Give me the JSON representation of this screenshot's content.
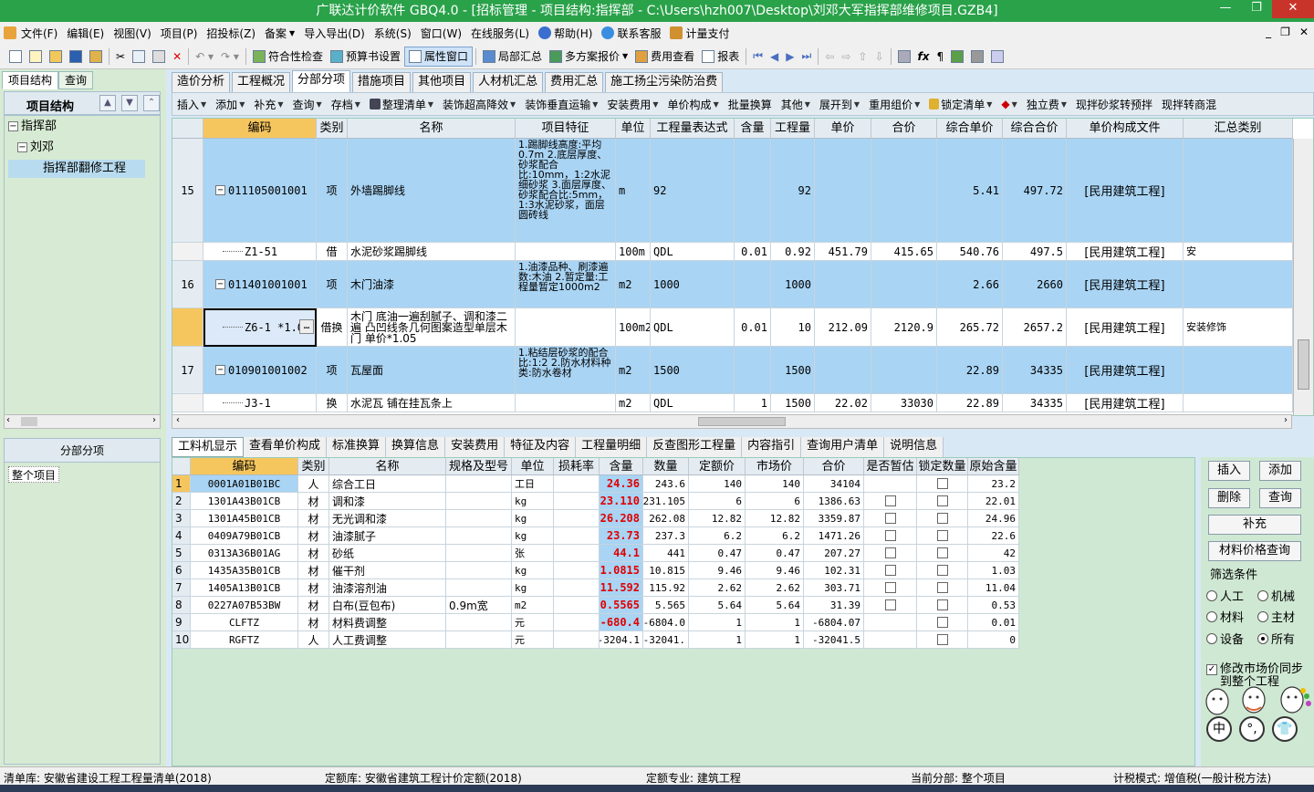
{
  "window": {
    "title": "广联达计价软件 GBQ4.0 - [招标管理 - 项目结构:指挥部 - C:\\Users\\hzh007\\Desktop\\刘邓大军指挥部维修项目.GZB4]"
  },
  "menu": {
    "items": [
      "文件(F)",
      "编辑(E)",
      "视图(V)",
      "项目(P)",
      "招投标(Z)",
      "备案",
      "导入导出(D)",
      "系统(S)",
      "窗口(W)",
      "在线服务(L)",
      "帮助(H)",
      "联系客服",
      "计量支付"
    ]
  },
  "toolbar": {
    "check": "符合性检查",
    "budget": "预算书设置",
    "attr_window": "属性窗口",
    "local_sum": "局部汇总",
    "multi_report": "多方案报价",
    "fee_view": "费用查看",
    "report": "报表"
  },
  "left": {
    "tab_structure": "项目结构",
    "tab_query": "查询",
    "header": "项目结构",
    "tree": [
      "指挥部",
      "刘邓",
      "指挥部翻修工程"
    ],
    "section_header": "分部分项",
    "section_item": "整个项目"
  },
  "tabs": [
    "造价分析",
    "工程概况",
    "分部分项",
    "措施项目",
    "其他项目",
    "人材机汇总",
    "费用汇总",
    "施工扬尘污染防治费"
  ],
  "subtoolbar": [
    "插入",
    "添加",
    "补充",
    "查询",
    "存档",
    "整理清单",
    "装饰超高降效",
    "装饰垂直运输",
    "安装费用",
    "单价构成",
    "批量换算",
    "其他",
    "展开到",
    "重用组价",
    "锁定清单",
    "独立费",
    "现拌砂浆转预拌",
    "现拌转商混"
  ],
  "grid": {
    "headers": [
      "",
      "编码",
      "类别",
      "名称",
      "项目特征",
      "单位",
      "工程量表达式",
      "含量",
      "工程量",
      "单价",
      "合价",
      "综合单价",
      "综合合价",
      "单价构成文件",
      "汇总类别"
    ],
    "rows": [
      {
        "no": "15",
        "code": "011105001001",
        "type": "项",
        "name": "外墙踢脚线",
        "feature": "1.踢脚线高度:平均0.7m 2.底层厚度、砂浆配合比:10mm，1:2水泥细砂浆 3.面层厚度、砂浆配合比:5mm，1:3水泥砂浆，面层圆砖线",
        "unit": "m",
        "expr": "92",
        "content": "",
        "qty": "92",
        "price": "",
        "total": "",
        "uprice": "5.41",
        "utotal": "497.72",
        "file": "[民用建筑工程]",
        "cat": ""
      },
      {
        "no": "",
        "code": "Z1-51",
        "type": "借",
        "name": "水泥砂浆踢脚线",
        "feature": "",
        "unit": "100m",
        "expr": "QDL",
        "content": "0.01",
        "qty": "0.92",
        "price": "451.79",
        "total": "415.65",
        "uprice": "540.76",
        "utotal": "497.5",
        "file": "[民用建筑工程]",
        "cat": "安"
      },
      {
        "no": "16",
        "code": "011401001001",
        "type": "项",
        "name": "木门油漆",
        "feature": "1.油漆品种、刷漆遍数:木油 2.暂定量:工程量暂定1000m2",
        "unit": "m2",
        "expr": "1000",
        "content": "",
        "qty": "1000",
        "price": "",
        "total": "",
        "uprice": "2.66",
        "utotal": "2660",
        "file": "[民用建筑工程]",
        "cat": ""
      },
      {
        "no": "",
        "code": "Z6-1 *1.05",
        "type": "借换",
        "name": "木门 底油一遍刮腻子、调和漆二遍 凸凹线条几何图案造型单层木门 单价*1.05",
        "feature": "",
        "unit": "100m2",
        "expr": "QDL",
        "content": "0.01",
        "qty": "10",
        "price": "212.09",
        "total": "2120.9",
        "uprice": "265.72",
        "utotal": "2657.2",
        "file": "[民用建筑工程]",
        "cat": "安装修饰"
      },
      {
        "no": "17",
        "code": "010901001002",
        "type": "项",
        "name": "瓦屋面",
        "feature": "1.粘结层砂浆的配合比:1:2 2.防水材料种类:防水卷材",
        "unit": "m2",
        "expr": "1500",
        "content": "",
        "qty": "1500",
        "price": "",
        "total": "",
        "uprice": "22.89",
        "utotal": "34335",
        "file": "[民用建筑工程]",
        "cat": ""
      },
      {
        "no": "",
        "code": "J3-1",
        "type": "换",
        "name": "水泥瓦 铺在挂瓦条上",
        "feature": "",
        "unit": "m2",
        "expr": "QDL",
        "content": "1",
        "qty": "1500",
        "price": "22.02",
        "total": "33030",
        "uprice": "22.89",
        "utotal": "34335",
        "file": "[民用建筑工程]",
        "cat": ""
      }
    ]
  },
  "bottom_tabs": [
    "工料机显示",
    "查看单价构成",
    "标准换算",
    "换算信息",
    "安装费用",
    "特征及内容",
    "工程量明细",
    "反查图形工程量",
    "内容指引",
    "查询用户清单",
    "说明信息"
  ],
  "materials": {
    "headers": [
      "",
      "编码",
      "类别",
      "名称",
      "规格及型号",
      "单位",
      "损耗率",
      "含量",
      "数量",
      "定额价",
      "市场价",
      "合价",
      "是否暂估",
      "锁定数量",
      "原始含量"
    ],
    "rows": [
      {
        "no": "1",
        "code": "0001A01B01BC",
        "type": "人",
        "name": "综合工日",
        "spec": "",
        "unit": "工日",
        "loss": "",
        "content": "24.36",
        "qty": "243.6",
        "dprice": "140",
        "mprice": "140",
        "total": "34104",
        "est": false,
        "lock": true,
        "orig": "23.2"
      },
      {
        "no": "2",
        "code": "1301A43B01CB",
        "type": "材",
        "name": "调和漆",
        "spec": "",
        "unit": "kg",
        "loss": "",
        "content": "23.110",
        "qty": "231.105",
        "dprice": "6",
        "mprice": "6",
        "total": "1386.63",
        "est": true,
        "lock": true,
        "orig": "22.01"
      },
      {
        "no": "3",
        "code": "1301A45B01CB",
        "type": "材",
        "name": "无光调和漆",
        "spec": "",
        "unit": "kg",
        "loss": "",
        "content": "26.208",
        "qty": "262.08",
        "dprice": "12.82",
        "mprice": "12.82",
        "total": "3359.87",
        "est": true,
        "lock": true,
        "orig": "24.96"
      },
      {
        "no": "4",
        "code": "0409A79B01CB",
        "type": "材",
        "name": "油漆腻子",
        "spec": "",
        "unit": "kg",
        "loss": "",
        "content": "23.73",
        "qty": "237.3",
        "dprice": "6.2",
        "mprice": "6.2",
        "total": "1471.26",
        "est": true,
        "lock": true,
        "orig": "22.6"
      },
      {
        "no": "5",
        "code": "0313A36B01AG",
        "type": "材",
        "name": "砂纸",
        "spec": "",
        "unit": "张",
        "loss": "",
        "content": "44.1",
        "qty": "441",
        "dprice": "0.47",
        "mprice": "0.47",
        "total": "207.27",
        "est": true,
        "lock": true,
        "orig": "42"
      },
      {
        "no": "6",
        "code": "1435A35B01CB",
        "type": "材",
        "name": "催干剂",
        "spec": "",
        "unit": "kg",
        "loss": "",
        "content": "1.0815",
        "qty": "10.815",
        "dprice": "9.46",
        "mprice": "9.46",
        "total": "102.31",
        "est": true,
        "lock": true,
        "orig": "1.03"
      },
      {
        "no": "7",
        "code": "1405A13B01CB",
        "type": "材",
        "name": "油漆溶剂油",
        "spec": "",
        "unit": "kg",
        "loss": "",
        "content": "11.592",
        "qty": "115.92",
        "dprice": "2.62",
        "mprice": "2.62",
        "total": "303.71",
        "est": true,
        "lock": true,
        "orig": "11.04"
      },
      {
        "no": "8",
        "code": "0227A07B53BW",
        "type": "材",
        "name": "白布(豆包布)",
        "spec": "0.9m宽",
        "unit": "m2",
        "loss": "",
        "content": "0.5565",
        "qty": "5.565",
        "dprice": "5.64",
        "mprice": "5.64",
        "total": "31.39",
        "est": true,
        "lock": true,
        "orig": "0.53"
      },
      {
        "no": "9",
        "code": "CLFTZ",
        "type": "材",
        "name": "材料费调整",
        "spec": "",
        "unit": "元",
        "loss": "",
        "content": "-680.4",
        "qty": "-6804.0",
        "dprice": "1",
        "mprice": "1",
        "total": "-6804.07",
        "est": false,
        "lock": true,
        "orig": "0.01"
      },
      {
        "no": "10",
        "code": "RGFTZ",
        "type": "人",
        "name": "人工费调整",
        "spec": "",
        "unit": "元",
        "loss": "",
        "content": "-3204.1",
        "qty": "-32041.",
        "dprice": "1",
        "mprice": "1",
        "total": "-32041.5",
        "est": false,
        "lock": true,
        "orig": "0"
      }
    ]
  },
  "right_panel": {
    "insert": "插入",
    "add": "添加",
    "delete": "删除",
    "query": "查询",
    "supplement": "补充",
    "price_query": "材料价格查询",
    "filter_label": "筛选条件",
    "filters": [
      "人工",
      "机械",
      "材料",
      "主材",
      "设备",
      "所有"
    ],
    "selected_filter": "所有",
    "sync_label": "修改市场价同步到整个工程"
  },
  "status": {
    "qd": "清单库:  安徽省建设工程工程量清单(2018)",
    "de": "定额库:  安徽省建筑工程计价定额(2018)",
    "major": "定额专业:  建筑工程",
    "current": "当前分部:  整个项目",
    "tax": "计税模式:  增值税(一般计税方法)"
  },
  "colors": {
    "titlebar": "#2aa24a",
    "selected_row": "#a9d4f4",
    "header_selected": "#f6c65e",
    "red_value": "#e00000"
  }
}
